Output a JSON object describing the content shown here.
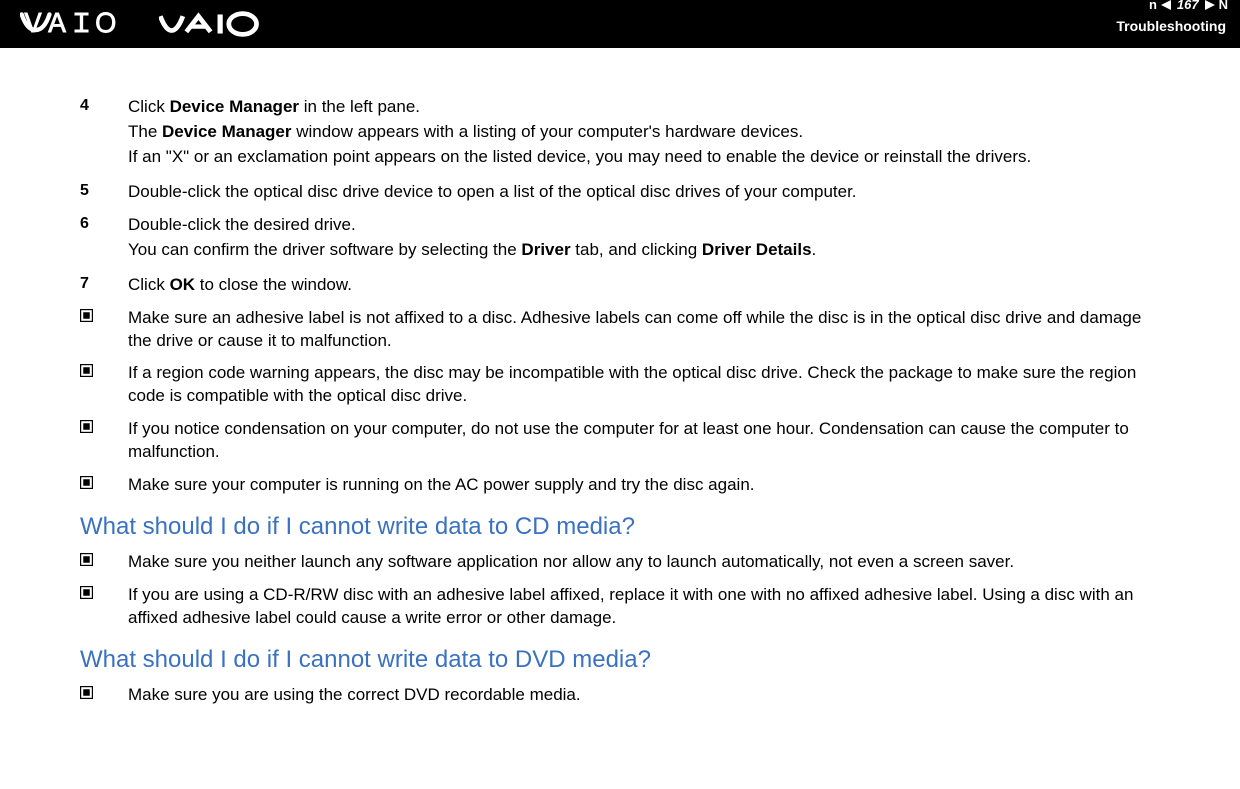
{
  "header": {
    "page_number": "167",
    "n_label": "n",
    "N_label": "N",
    "title": "Troubleshooting"
  },
  "steps": {
    "s4": {
      "num": "4",
      "line1_pre": "Click ",
      "line1_bold": "Device Manager",
      "line1_post": " in the left pane.",
      "line2_pre": "The ",
      "line2_bold": "Device Manager",
      "line2_post": " window appears with a listing of your computer's hardware devices.",
      "line3": "If an \"X\" or an exclamation point appears on the listed device, you may need to enable the device or reinstall the drivers."
    },
    "s5": {
      "num": "5",
      "text": "Double-click the optical disc drive device to open a list of the optical disc drives of your computer."
    },
    "s6": {
      "num": "6",
      "line1": "Double-click the desired drive.",
      "line2_pre": "You can confirm the driver software by selecting the ",
      "line2_bold1": "Driver",
      "line2_mid": " tab, and clicking ",
      "line2_bold2": "Driver Details",
      "line2_post": "."
    },
    "s7": {
      "num": "7",
      "pre": "Click ",
      "bold": "OK",
      "post": " to close the window."
    }
  },
  "bullets1": {
    "b1": "Make sure an adhesive label is not affixed to a disc. Adhesive labels can come off while the disc is in the optical disc drive and damage the drive or cause it to malfunction.",
    "b2": "If a region code warning appears, the disc may be incompatible with the optical disc drive. Check the package to make sure the region code is compatible with the optical disc drive.",
    "b3": "If you notice condensation on your computer, do not use the computer for at least one hour. Condensation can cause the computer to malfunction.",
    "b4": "Make sure your computer is running on the AC power supply and try the disc again."
  },
  "heading1": "What should I do if I cannot write data to CD media?",
  "bullets2": {
    "b1": "Make sure you neither launch any software application nor allow any to launch automatically, not even a screen saver.",
    "b2": "If you are using a CD-R/RW disc with an adhesive label affixed, replace it with one with no affixed adhesive label. Using a disc with an affixed adhesive label could cause a write error or other damage."
  },
  "heading2": "What should I do if I cannot write data to DVD media?",
  "bullets3": {
    "b1": "Make sure you are using the correct DVD recordable media."
  }
}
